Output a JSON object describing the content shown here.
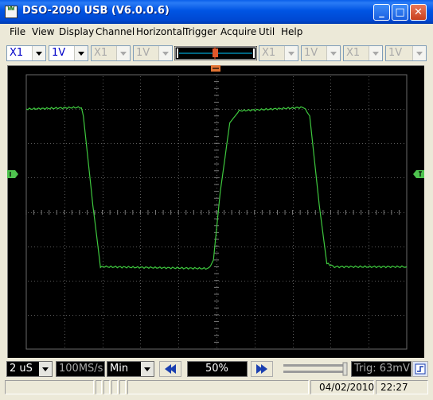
{
  "window": {
    "title": "DSO-2090 USB (V6.0.0.6)",
    "icon_text": "WW",
    "buttons": {
      "minimize": "_",
      "maximize": "□",
      "close": "✕"
    }
  },
  "menu": [
    "File",
    "View",
    "Display",
    "Channel",
    "Horizontal",
    "Trigger",
    "Acquire",
    "Util",
    "Help"
  ],
  "toolbar": {
    "ch1_probe": "X1",
    "ch1_volts": "1V",
    "ch2_probe": "X1",
    "ch2_volts": "1V",
    "ch3_probe": "X1",
    "ch3_volts": "1V",
    "ch4_probe": "X1",
    "ch4_volts": "1V"
  },
  "scope": {
    "divisions_x": 10,
    "divisions_y": 8,
    "grid_color": "#5a5a5a",
    "trace_color": "#3ec83e",
    "marker_color": "#4ec34e",
    "trigger_marker_color": "#e37433"
  },
  "waveform": {
    "type": "square",
    "x_units": "divisions",
    "y_units": "divisions",
    "xlim": [
      0,
      10
    ],
    "ylim": [
      -4,
      4
    ],
    "points": [
      [
        0,
        3.0
      ],
      [
        1.45,
        3.05
      ],
      [
        1.5,
        2.8
      ],
      [
        1.75,
        0.2
      ],
      [
        1.95,
        -1.6
      ],
      [
        2.1,
        -1.6
      ],
      [
        4.8,
        -1.65
      ],
      [
        4.92,
        -1.4
      ],
      [
        5.1,
        0.6
      ],
      [
        5.35,
        2.6
      ],
      [
        5.6,
        2.95
      ],
      [
        7.3,
        3.05
      ],
      [
        7.45,
        2.8
      ],
      [
        7.7,
        0.2
      ],
      [
        7.9,
        -1.5
      ],
      [
        8.1,
        -1.6
      ],
      [
        10,
        -1.6
      ]
    ]
  },
  "controls": {
    "timebase": "2 uS",
    "samplerate": "100MS/s",
    "mode": "Min",
    "position": "50%",
    "trigger": "Trig: 63mV"
  },
  "status": {
    "date": "04/02/2010",
    "time": "22:27"
  },
  "colors": {
    "window_blue": "#0054e3",
    "label_blue": "#0000c8",
    "accent_cyan": "#00c8ff",
    "knob_orange": "#e0572b"
  }
}
